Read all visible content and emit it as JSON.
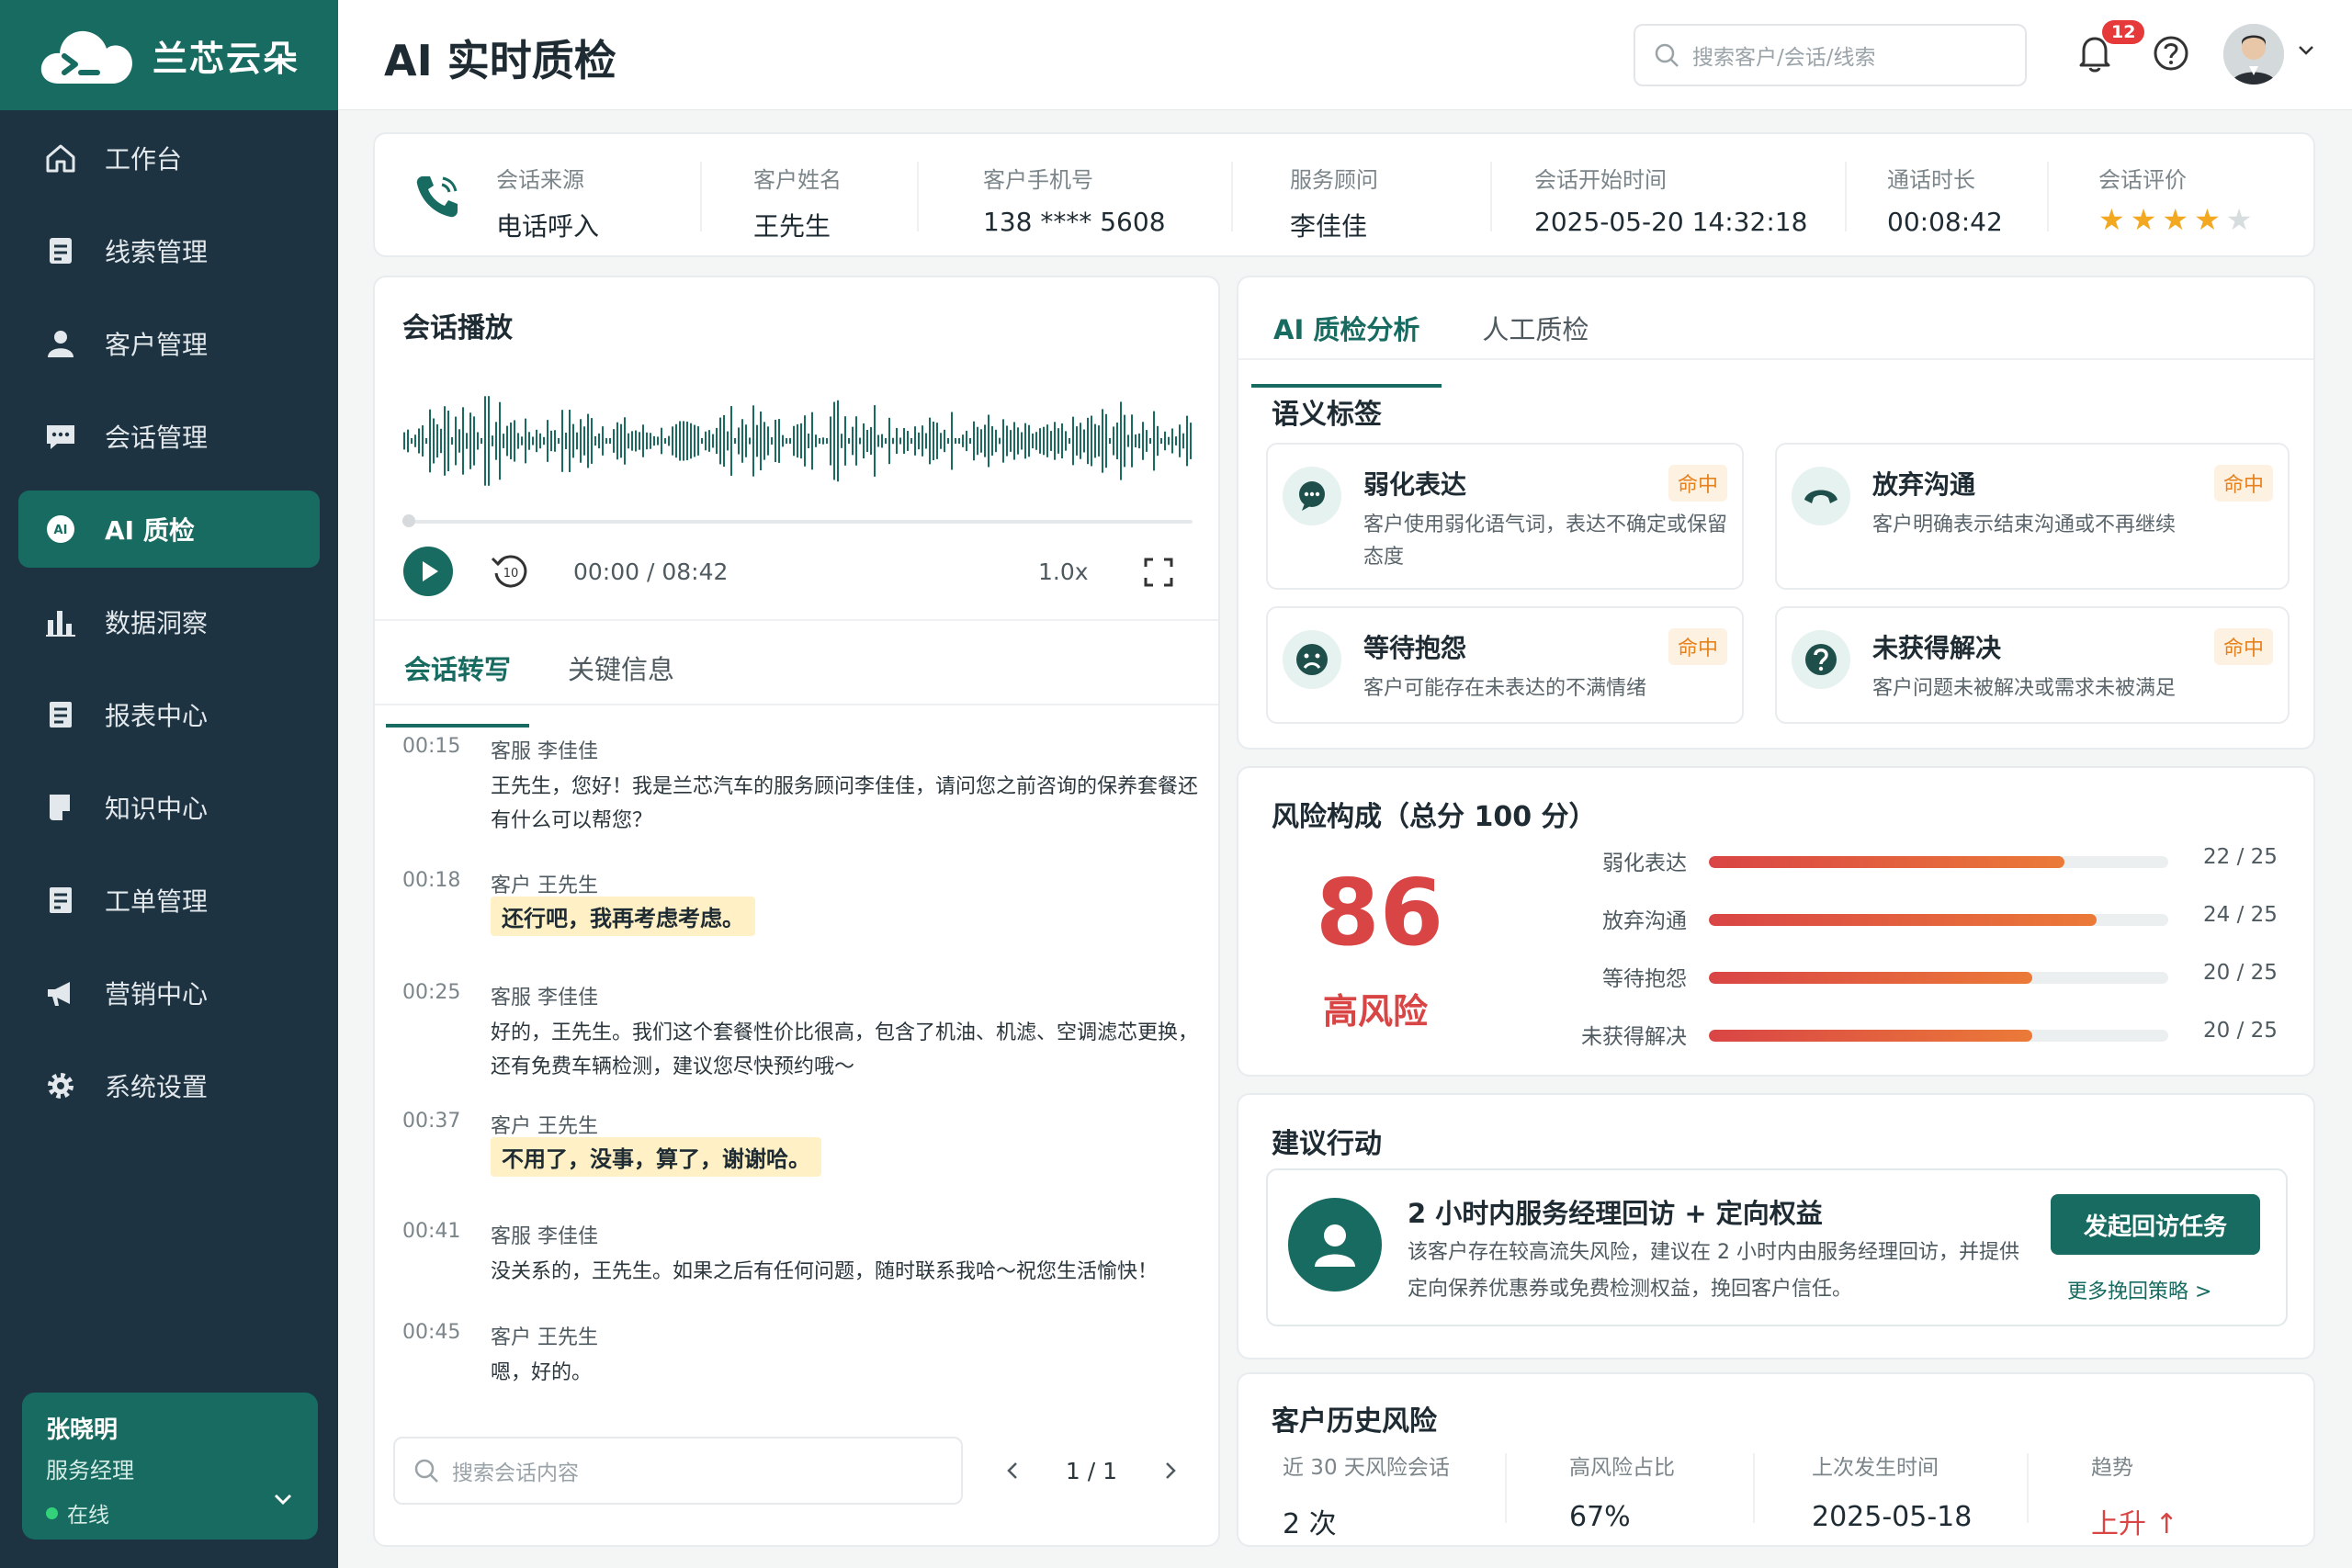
{
  "app": {
    "name": "兰芯云朵"
  },
  "sidebar": {
    "items": [
      {
        "label": "工作台",
        "icon": "home-icon"
      },
      {
        "label": "线索管理",
        "icon": "clipboard-icon"
      },
      {
        "label": "客户管理",
        "icon": "user-icon"
      },
      {
        "label": "会话管理",
        "icon": "chat-icon"
      },
      {
        "label": "AI 质检",
        "icon": "ai-icon",
        "active": true
      },
      {
        "label": "数据洞察",
        "icon": "bar-chart-icon"
      },
      {
        "label": "报表中心",
        "icon": "report-icon"
      },
      {
        "label": "知识中心",
        "icon": "book-icon"
      },
      {
        "label": "工单管理",
        "icon": "ticket-icon"
      },
      {
        "label": "营销中心",
        "icon": "megaphone-icon"
      },
      {
        "label": "系统设置",
        "icon": "gear-icon"
      }
    ],
    "user": {
      "name": "张晓明",
      "role": "服务经理",
      "status": "在线"
    }
  },
  "header": {
    "title": "AI 实时质检",
    "search_placeholder": "搜索客户/会话/线索",
    "notifications": "12"
  },
  "info": {
    "source_label": "会话来源",
    "source": "电话呼入",
    "name_label": "客户姓名",
    "name": "王先生",
    "phone_label": "客户手机号",
    "phone": "138 **** 5608",
    "advisor_label": "服务顾问",
    "advisor": "李佳佳",
    "start_label": "会话开始时间",
    "start": "2025-05-20 14:32:18",
    "duration_label": "通话时长",
    "duration": "00:08:42",
    "rating_label": "会话评价",
    "rating": 4,
    "rating_max": 5
  },
  "player": {
    "title": "会话播放",
    "time": "00:00 / 08:42",
    "speed": "1.0x",
    "progress": 0
  },
  "transcript": {
    "tabs": [
      "会话转写",
      "关键信息"
    ],
    "messages": [
      {
        "time": "00:15",
        "speaker": "客服 李佳佳",
        "text": "王先生，您好！我是兰芯汽车的服务顾问李佳佳，请问您之前咨询的保养套餐还有什么可以帮您？",
        "highlight": false
      },
      {
        "time": "00:18",
        "speaker": "客户 王先生",
        "text": "还行吧，我再考虑考虑。",
        "highlight": true
      },
      {
        "time": "00:25",
        "speaker": "客服 李佳佳",
        "text": "好的，王先生。我们这个套餐性价比很高，包含了机油、机滤、空调滤芯更换，还有免费车辆检测，建议您尽快预约哦～",
        "highlight": false
      },
      {
        "time": "00:37",
        "speaker": "客户 王先生",
        "text": "不用了，没事，算了，谢谢哈。",
        "highlight": true
      },
      {
        "time": "00:41",
        "speaker": "客服 李佳佳",
        "text": "没关系的，王先生。如果之后有任何问题，随时联系我哈～祝您生活愉快！",
        "highlight": false
      },
      {
        "time": "00:45",
        "speaker": "客户 王先生",
        "text": "嗯，好的。",
        "highlight": false
      }
    ],
    "search_placeholder": "搜索会话内容",
    "page": "1 / 1"
  },
  "ai": {
    "tabs": [
      "AI 质检分析",
      "人工质检"
    ],
    "tags_title": "语义标签",
    "tags": [
      {
        "name": "弱化表达",
        "hit": "命中",
        "desc": "客户使用弱化语气词，表达不确定或保留态度",
        "icon": "chat-bubble-icon"
      },
      {
        "name": "放弃沟通",
        "hit": "命中",
        "desc": "客户明确表示结束沟通或不再继续",
        "icon": "hang-up-icon"
      },
      {
        "name": "等待抱怨",
        "hit": "命中",
        "desc": "客户可能存在未表达的不满情绪",
        "icon": "sad-face-icon"
      },
      {
        "name": "未获得解决",
        "hit": "命中",
        "desc": "客户问题未被解决或需求未被满足",
        "icon": "question-icon"
      }
    ]
  },
  "risk": {
    "title": "风险构成（总分 100 分）",
    "score": "86",
    "level": "高风险",
    "items": [
      {
        "label": "弱化表达",
        "value": 22,
        "max": 25,
        "text": "22 / 25"
      },
      {
        "label": "放弃沟通",
        "value": 24,
        "max": 25,
        "text": "24 / 25"
      },
      {
        "label": "等待抱怨",
        "value": 20,
        "max": 25,
        "text": "20 / 25"
      },
      {
        "label": "未获得解决",
        "value": 20,
        "max": 25,
        "text": "20 / 25"
      }
    ]
  },
  "suggest": {
    "title": "建议行动",
    "heading": "2 小时内服务经理回访 + 定向权益",
    "desc": "该客户存在较高流失风险，建议在 2 小时内由服务经理回访，并提供定向保养优惠券或免费检测权益，挽回客户信任。",
    "button": "发起回访任务",
    "link": "更多挽回策略 >"
  },
  "history": {
    "title": "客户历史风险",
    "count_label": "近 30 天风险会话",
    "count": "2 次",
    "ratio_label": "高风险占比",
    "ratio": "67%",
    "last_label": "上次发生时间",
    "last": "2025-05-18",
    "trend_label": "趋势",
    "trend": "上升 ↑"
  },
  "colors": {
    "brand": "#176b60",
    "sidebar": "#1e3341",
    "risk": "#d94545",
    "star": "#f3a821"
  }
}
